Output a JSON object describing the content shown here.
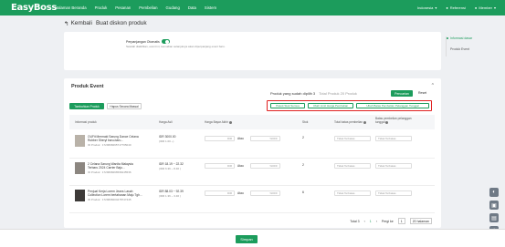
{
  "nav": {
    "logo": "EasyBoss",
    "items": [
      "Halaman Beranda",
      "Produk",
      "Pesanan",
      "Pembelian",
      "Gudang",
      "Data",
      "Sistem"
    ],
    "lang": "Indonesia",
    "referral": "Referensi",
    "member": "Member"
  },
  "page": {
    "back_label": "Kembali",
    "title": "Buat diskon produk"
  },
  "settings": {
    "toggle_label": "Perpanjangan Otomatis",
    "toggle_desc": "Setelah diaktifkan, event ini, kemudian selanjutnya akan diperpanjang event baru."
  },
  "section": {
    "title": "Produk Event",
    "collapse": "^",
    "selected_label": "Produk yang sudah dipilih 3",
    "selected_hint": "Total Produk 20 Produk",
    "search_btn": "Pencarian",
    "reset_btn": "Reset",
    "add_btn": "Tambahkan Produk",
    "delete_btn": "Hapus Secara Massal",
    "bulk_buttons": [
      "Pasok Stok Semua",
      "Ubah Limit Harga Pembelian",
      "Ubah Batas Pembelian Pelanggan Tunggal"
    ]
  },
  "table": {
    "headers": [
      "Informasi produk",
      "Harga Asli",
      "Harga Bayar Akhir",
      "Stok",
      "Total batas pembelian",
      "Batas pembelian pelanggan tunggal"
    ],
    "rows": [
      {
        "name": "OUFit Mermaid Sarung Dance Celana Rubber Sheryl baru-baru...",
        "id": "ID Produk : 1729698295717765040",
        "price": "IDR 3000.00",
        "price_sub": "(IDR 1.00 ~)",
        "stock": "2",
        "unit": "IDR",
        "discount": "%OFF",
        "atau": "Atau",
        "limit_placeholder": "Tidak Terbatas"
      },
      {
        "name": "2 Celana Sarung Wanita Malaysia Terbaru 2024 Carrier Baju...",
        "id": "ID Produk : 1729698296596245536",
        "price": "IDR 18.19 ~ 22.32",
        "price_sub": "(IDR 6.36 ~ 8.46 )",
        "stock": "2",
        "unit": "IDR",
        "discount": "%OFF",
        "atau": "Atau",
        "limit_placeholder": "Tidak Terbatas"
      },
      {
        "name": "Penjual Kerja Lorem Jeans Lasah Collection Lorem bertahanan Maju Tgh...",
        "id": "ID Produk : 1729698204278747445",
        "price": "IDR 88.03 ~ 92.39",
        "price_sub": "(IDR 1.36 ~ 3.46 )",
        "stock": "6",
        "unit": "IDR",
        "discount": "%OFF",
        "atau": "Atau",
        "limit_placeholder": "Tidak Terbatas"
      }
    ]
  },
  "pager": {
    "total": "Total 3",
    "page": "1",
    "goto_label": "Pergi ke",
    "goto_value": "1",
    "page_size": "20 halaman"
  },
  "sidebar": {
    "items": [
      "Informasi dasar",
      "Produk Event"
    ]
  },
  "footer": {
    "save_btn": "Simpan"
  },
  "colors": {
    "brand": "#1c9c5c",
    "highlight": "#e02020"
  }
}
